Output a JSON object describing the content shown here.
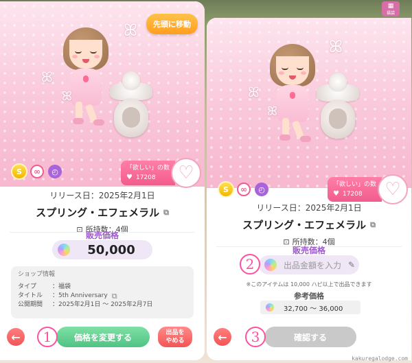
{
  "left": {
    "move_to_top": "先頭に移動",
    "wish": {
      "label": "「欲しい」の数",
      "count": "17208"
    },
    "release": "リリース日：2025年2月1日",
    "name": "スプリング・エフェメラル",
    "owned": "所持数：4個",
    "price_title": "販売価格",
    "price": "50,000",
    "shop": {
      "header": "ショップ情報",
      "rows": [
        {
          "k": "タイプ",
          "v": "：福袋"
        },
        {
          "k": "タイトル",
          "v": "：5th Anniversary"
        },
        {
          "k": "公開期間",
          "v": "：2025年2月1日 ～ 2025年2月7日"
        }
      ]
    },
    "change_price": "価格を変更する",
    "stop_line1": "出品を",
    "stop_line2": "やめる",
    "step": "1"
  },
  "right": {
    "wish": {
      "label": "「欲しい」の数",
      "count": "17208"
    },
    "release": "リリース日：2025年2月1日",
    "name": "スプリング・エフェメラル",
    "owned": "所持数：4個",
    "price_title": "販売価格",
    "input_placeholder": "出品金額を入力",
    "step_input": "2",
    "note": "※このアイテムは 10,000 ハピ以上で出品できます",
    "ref_title": "参考価格",
    "ref_range": "32,700 ～ 36,000",
    "confirm": "確認する",
    "step_confirm": "3"
  },
  "corner_label": "福袋",
  "watermark": "kakuregalodge.com",
  "icons": {
    "badge_s": "S",
    "badge_infinity": "∞",
    "heart": "♥",
    "heart_outline": "♡",
    "back": "←",
    "copy": "⧉",
    "bag": "⊡",
    "pencil": "✎",
    "butterfly": "ꕤ",
    "grid": "▦"
  }
}
